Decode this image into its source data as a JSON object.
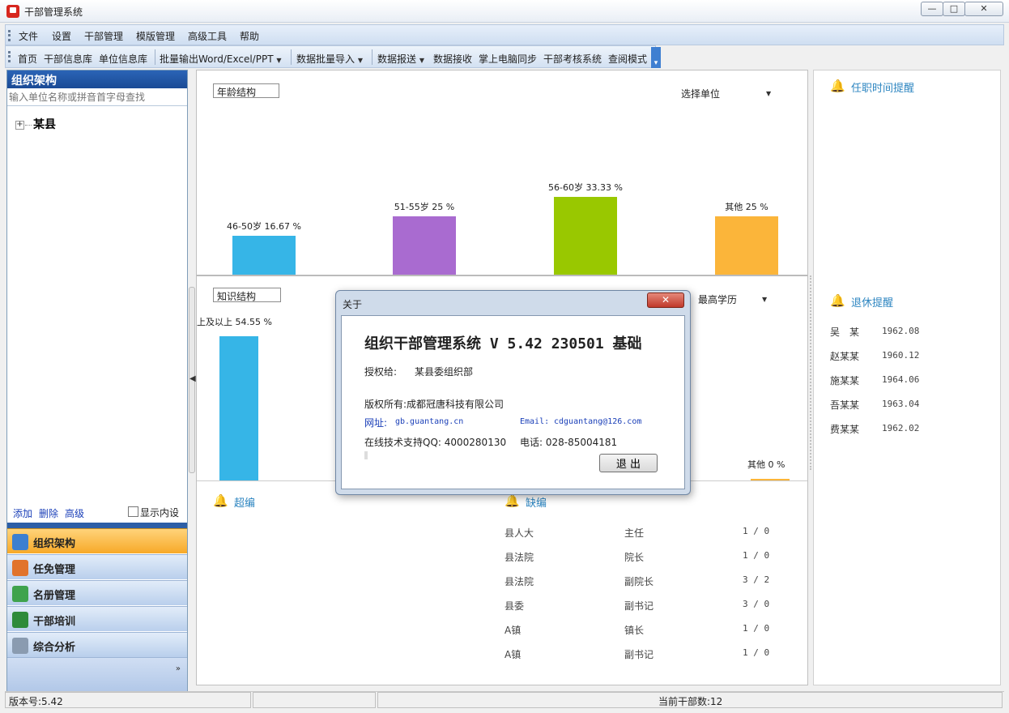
{
  "window": {
    "title": "干部管理系统"
  },
  "menu": [
    "文件",
    "设置",
    "干部管理",
    "模版管理",
    "高级工具",
    "帮助"
  ],
  "toolbar": {
    "items": [
      "首页",
      "干部信息库",
      "单位信息库",
      "批量输出Word/Excel/PPT",
      "数据批量导入",
      "数据报送",
      "数据接收",
      "掌上电脑同步",
      "干部考核系统",
      "查阅模式"
    ],
    "dropdown_items": [
      "批量输出Word/Excel/PPT",
      "数据批量导入",
      "数据报送"
    ]
  },
  "left": {
    "header": "组织架构",
    "search_placeholder": "输入单位名称或拼音首字母查找",
    "tree_root": "某县",
    "links": [
      "添加",
      "删除",
      "高级"
    ],
    "show_inner_label": "显示内设",
    "nav": [
      {
        "label": "组织架构",
        "icon": "org-chart-icon",
        "active": true
      },
      {
        "label": "任免管理",
        "icon": "appointment-icon",
        "active": false
      },
      {
        "label": "名册管理",
        "icon": "roster-icon",
        "active": false
      },
      {
        "label": "干部培训",
        "icon": "training-book-icon",
        "active": false
      },
      {
        "label": "综合分析",
        "icon": "analysis-magnifier-icon",
        "active": false
      }
    ]
  },
  "charts": {
    "age": {
      "selector_label": "年龄结构",
      "unit_label": "选择单位",
      "chart_data": {
        "type": "bar",
        "categories": [
          "46-50岁",
          "51-55岁",
          "56-60岁",
          "其他"
        ],
        "values": [
          16.67,
          25,
          33.33,
          25
        ],
        "data_labels": [
          "46-50岁 16.67 %",
          "51-55岁 25 %",
          "56-60岁 33.33 %",
          "其他 25 %"
        ],
        "colors": [
          "#36b5e7",
          "#a96bd0",
          "#99c800",
          "#fbb53a"
        ],
        "ylim": [
          0,
          40
        ]
      }
    },
    "knowledge": {
      "selector_label": "知识结构",
      "unit_label": "最高学历",
      "chart_data": {
        "type": "bar",
        "categories": [
          "大学及以上",
          "其他"
        ],
        "values": [
          54.55,
          0
        ],
        "data_labels": [
          "上及以上 54.55 %",
          "其他 0 %"
        ],
        "colors": [
          "#36b5e7",
          "#fbb53a"
        ],
        "ylim": [
          0,
          60
        ]
      }
    }
  },
  "right": {
    "tenure_title": "任职时间提醒",
    "retire_title": "退休提醒",
    "retirements": [
      {
        "name": "吴　某",
        "date": "1962.08"
      },
      {
        "name": "赵某某",
        "date": "1960.12"
      },
      {
        "name": "施某某",
        "date": "1964.06"
      },
      {
        "name": "吾某某",
        "date": "1963.04"
      },
      {
        "name": "费某某",
        "date": "1962.02"
      }
    ]
  },
  "overview": {
    "over_title": "超编",
    "short_title": "缺编",
    "short_rows": [
      {
        "unit": "县人大",
        "post": "主任",
        "count": "1 / 0"
      },
      {
        "unit": "县法院",
        "post": "院长",
        "count": "1 / 0"
      },
      {
        "unit": "县法院",
        "post": "副院长",
        "count": "3 / 2"
      },
      {
        "unit": "县委",
        "post": "副书记",
        "count": "3 / 0"
      },
      {
        "unit": "A镇",
        "post": "镇长",
        "count": "1 / 0"
      },
      {
        "unit": "A镇",
        "post": "副书记",
        "count": "1 / 0"
      }
    ]
  },
  "status": {
    "version": "版本号:5.42",
    "count": "当前干部数:12"
  },
  "dialog": {
    "title": "关于",
    "heading": "组织干部管理系统 V 5.42 230501 基础",
    "licensed_label": "授权给:",
    "licensed_to": "某县委组织部",
    "copyright": "版权所有:成都冠唐科技有限公司",
    "site_label": "网址:",
    "site": "gb.guantang.cn",
    "email_label": "Email:",
    "email": "cdguantang@126.com",
    "support": "在线技术支持QQ: 4000280130",
    "phone": "电话: 028-85004181",
    "exit_label": "退 出"
  }
}
